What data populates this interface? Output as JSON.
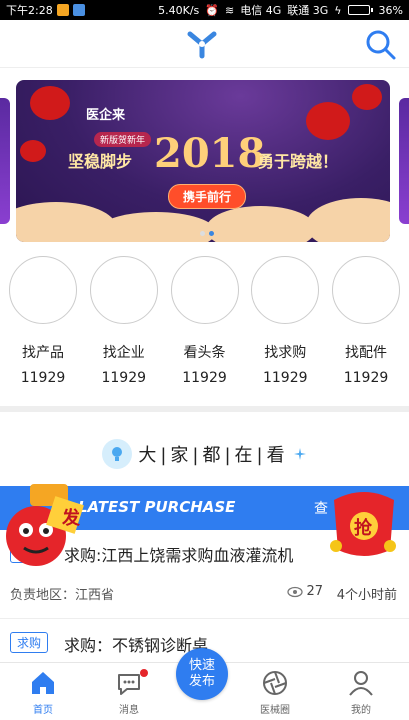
{
  "status_bar": {
    "time": "下午2:28",
    "network_speed": "5.40K/s",
    "carrier1": "电信 4G",
    "carrier2": "联通 3G",
    "battery": "36%",
    "battery_level": 0.36
  },
  "header": {
    "logo_icon": "brand-logo-icon",
    "search_icon": "search-icon"
  },
  "banner": {
    "brand": "医企来",
    "sub_pill": "新版贺新年",
    "slogan_left": "坚稳脚步",
    "year": "2018",
    "slogan_right": "勇于跨越！",
    "button": "携手前行",
    "active_dot": 1
  },
  "categories": [
    {
      "label": "找产品",
      "count": "11929"
    },
    {
      "label": "找企业",
      "count": "11929"
    },
    {
      "label": "看头条",
      "count": "11929"
    },
    {
      "label": "找求购",
      "count": "11929"
    },
    {
      "label": "找配件",
      "count": "11929"
    }
  ],
  "watch": {
    "title": "大|家|都|在|看"
  },
  "latest": {
    "label": "LATEST PURCHASE",
    "more": "查"
  },
  "items": [
    {
      "tag": "求购",
      "title": "求购:江西上饶需求购血液灌流机",
      "region": "负责地区：江西省",
      "views": "27",
      "time": "4个小时前"
    },
    {
      "tag": "求购",
      "title": "求购：不锈钢诊断桌"
    }
  ],
  "badges": {
    "left_char": "发",
    "right_char": "抢"
  },
  "tabbar": {
    "tabs": [
      {
        "label": "首页",
        "icon": "home-icon",
        "active": true
      },
      {
        "label": "消息",
        "icon": "message-icon",
        "active": false
      },
      {
        "label": "医械圈",
        "icon": "aperture-icon",
        "active": false
      },
      {
        "label": "我的",
        "icon": "profile-icon",
        "active": false
      }
    ],
    "fab_line1": "快速",
    "fab_line2": "发布"
  },
  "colors": {
    "accent": "#2f7df0",
    "notification": "#e5252a"
  }
}
